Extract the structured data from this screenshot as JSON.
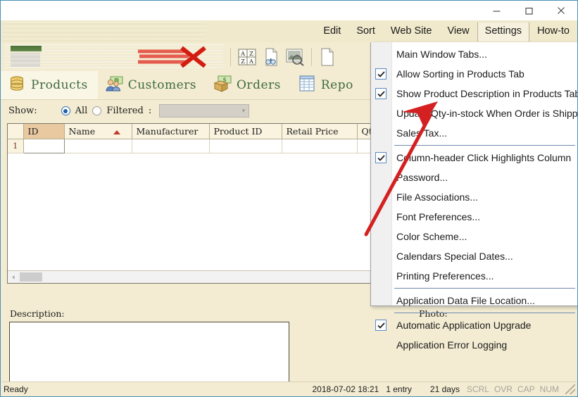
{
  "window": {
    "minimize_label": "—",
    "maximize_label": "□",
    "close_label": "✕"
  },
  "menubar": {
    "items": [
      {
        "label": "Edit",
        "active": false
      },
      {
        "label": "Sort",
        "active": false
      },
      {
        "label": "Web Site",
        "active": false
      },
      {
        "label": "View",
        "active": false
      },
      {
        "label": "Settings",
        "active": true
      },
      {
        "label": "How-to",
        "active": false
      }
    ]
  },
  "toolbar": {
    "sort_az_top": "A",
    "sort_az_bottom": "Z",
    "sort_za_top": "Z",
    "sort_za_bottom": "A",
    "icons": [
      "sort-az-za-icon",
      "find-document-icon",
      "image-preview-icon",
      "document-stamp-icon"
    ]
  },
  "tabs": [
    {
      "label": "Products",
      "icon": "database-icon",
      "selected": true
    },
    {
      "label": "Customers",
      "icon": "customers-icon",
      "selected": false
    },
    {
      "label": "Orders",
      "icon": "orders-money-icon",
      "selected": false
    },
    {
      "label": "Repo",
      "icon": "reports-grid-icon",
      "selected": false
    }
  ],
  "show_row": {
    "label": "Show:",
    "option_all": "All",
    "option_filtered": "Filtered",
    "colon": ":",
    "selected": "All",
    "filter_value": "",
    "filter_placeholder": ""
  },
  "grid": {
    "columns": [
      "ID",
      "Name",
      "Manufacturer",
      "Product ID",
      "Retail Price",
      "Qty In Stock"
    ],
    "sorted_column": "Name",
    "sort_direction": "ascending",
    "rows": [
      {
        "num": "1",
        "ID": "",
        "Name": "",
        "Manufacturer": "",
        "Product ID": "",
        "Retail Price": "",
        "Qty In Stock": ""
      }
    ],
    "scroll_left_arrow": "‹"
  },
  "detail": {
    "description_label": "Description:",
    "description_value": "",
    "photo_label": "Photo:"
  },
  "statusbar": {
    "message": "Ready",
    "datetime": "2018-07-02 18:21",
    "entries": "1 entry",
    "days": "21 days",
    "indicators": [
      "SCRL",
      "OVR",
      "CAP",
      "NUM"
    ]
  },
  "settings_menu": {
    "items": [
      {
        "label": "Main Window Tabs...",
        "checkbox": false,
        "checked": false,
        "separator_after": false
      },
      {
        "label": "Allow Sorting in Products Tab",
        "checkbox": true,
        "checked": true,
        "separator_after": false
      },
      {
        "label": "Show Product Description in Products Tab",
        "checkbox": true,
        "checked": true,
        "separator_after": false
      },
      {
        "label": "Update Qty-in-stock When Order is Shipped",
        "checkbox": true,
        "checked": false,
        "separator_after": false
      },
      {
        "label": "Sales Tax...",
        "checkbox": false,
        "checked": false,
        "separator_after": true
      },
      {
        "label": "Column-header Click Highlights Column",
        "checkbox": true,
        "checked": true,
        "separator_after": false
      },
      {
        "label": "Password...",
        "checkbox": false,
        "checked": false,
        "separator_after": false
      },
      {
        "label": "File Associations...",
        "checkbox": false,
        "checked": false,
        "separator_after": false
      },
      {
        "label": "Font Preferences...",
        "checkbox": false,
        "checked": false,
        "separator_after": false
      },
      {
        "label": "Color Scheme...",
        "checkbox": false,
        "checked": false,
        "separator_after": false
      },
      {
        "label": "Calendars Special Dates...",
        "checkbox": false,
        "checked": false,
        "separator_after": false
      },
      {
        "label": "Printing Preferences...",
        "checkbox": false,
        "checked": false,
        "separator_after": true
      },
      {
        "label": "Application Data File Location...",
        "checkbox": false,
        "checked": false,
        "separator_after": true
      },
      {
        "label": "Automatic Application Upgrade",
        "checkbox": true,
        "checked": true,
        "separator_after": false
      },
      {
        "label": "Application Error Logging",
        "checkbox": false,
        "checked": false,
        "separator_after": false
      }
    ]
  },
  "annotation": {
    "type": "red-arrow",
    "color": "#d42020",
    "points_at": "Update Qty-in-stock When Order is Shipped"
  },
  "colors": {
    "window_background": "#f3ecd2",
    "menu_background": "#f0e9cc",
    "tab_text": "#3f6b3f",
    "header_row": "#faf3df",
    "id_header": "#e8c9a0",
    "accent_blue": "#5a8ac4",
    "annotation_red": "#d42020"
  }
}
